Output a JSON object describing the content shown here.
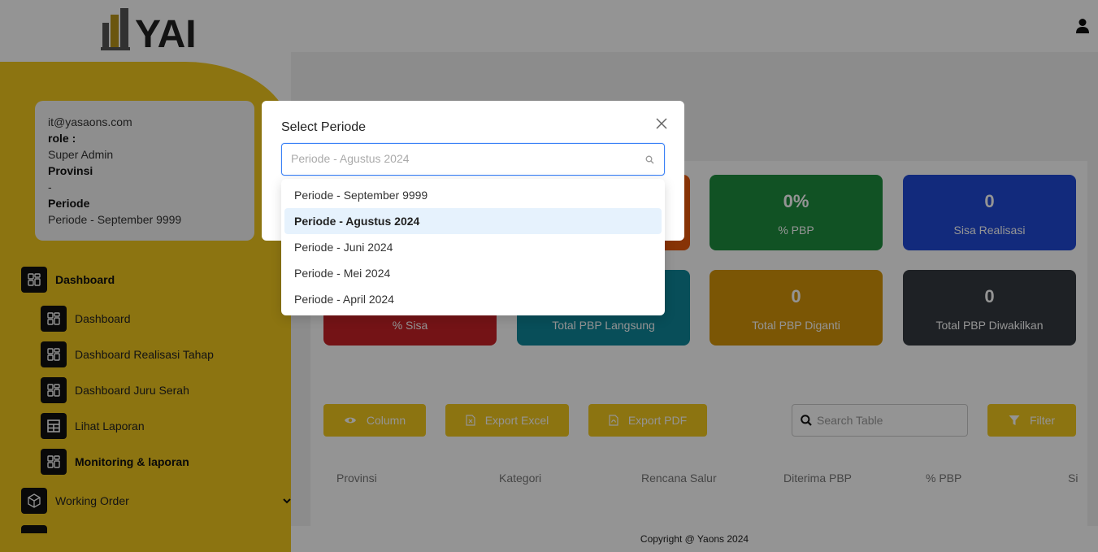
{
  "header": {
    "logo_text": "YAI",
    "user_icon": "user-icon"
  },
  "profile": {
    "email": "it@yasaons.com",
    "role_label": "role :",
    "role_value": "Super Admin",
    "provinsi_label": "Provinsi",
    "provinsi_value": "-",
    "periode_label": "Periode",
    "periode_value": "Periode - September 9999"
  },
  "sidebar": {
    "group": {
      "label": "Dashboard",
      "icon": "dashboard-grid-icon",
      "chevron": "chevron-up-icon"
    },
    "items": [
      {
        "label": "Dashboard",
        "icon": "dashboard-grid-icon"
      },
      {
        "label": "Dashboard Realisasi Tahap",
        "icon": "dashboard-grid-icon"
      },
      {
        "label": "Dashboard Juru Serah",
        "icon": "dashboard-grid-icon"
      },
      {
        "label": "Lihat Laporan",
        "icon": "table-icon"
      },
      {
        "label": "Monitoring & laporan",
        "icon": "dashboard-grid-icon",
        "active": true
      }
    ],
    "working_order": {
      "label": "Working Order",
      "icon": "box-icon",
      "chevron": "chevron-down-icon"
    }
  },
  "stats": [
    {
      "value": "0%",
      "label": "% PBP",
      "color": "#1e8e3e"
    },
    {
      "value": "0",
      "label": "Sisa Realisasi",
      "color": "#1f49d6"
    },
    {
      "value": "",
      "label": "% Sisa",
      "color": "#c82127"
    },
    {
      "value": "",
      "label": "Total PBP Langsung",
      "color": "#0e879a"
    },
    {
      "value": "0",
      "label": "Total PBP Diganti",
      "color": "#d4950a"
    },
    {
      "value": "0",
      "label": "Total PBP Diwakilkan",
      "color": "#343a40"
    }
  ],
  "toolbar": {
    "column_label": "Column",
    "export_excel_label": "Export Excel",
    "export_pdf_label": "Export PDF",
    "search_placeholder": "Search Table",
    "filter_label": "Filter"
  },
  "table": {
    "columns": [
      "Provinsi",
      "Kategori",
      "Rencana Salur",
      "Diterima PBP",
      "% PBP",
      "Si"
    ]
  },
  "footer": {
    "copyright": "Copyright @ Yaons 2024"
  },
  "modal": {
    "title": "Select Periode",
    "placeholder": "Periode - Agustus 2024",
    "options": [
      "Periode - September 9999",
      "Periode - Agustus 2024",
      "Periode - Juni 2024",
      "Periode - Mei 2024",
      "Periode - April 2024"
    ],
    "highlighted_option": "Periode - Agustus 2024"
  },
  "colors": {
    "accent": "#f2c81e",
    "select_focus": "#3b82f6"
  }
}
